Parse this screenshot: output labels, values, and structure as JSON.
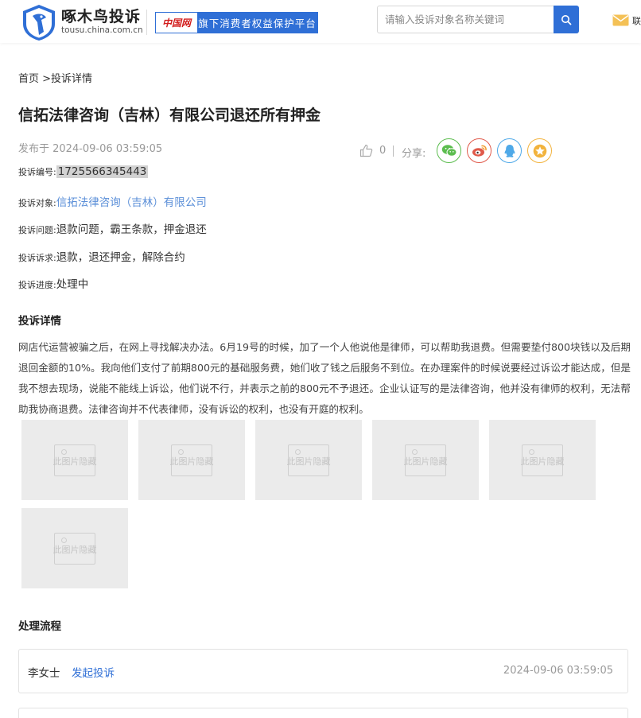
{
  "header": {
    "site_name": "啄木鸟投诉",
    "site_url": "tousu.china.com.cn",
    "partner_logo_text": "中国网",
    "partner_tagline": "旗下消费者权益保护平台",
    "search_placeholder": "请输入投诉对象名称关键词",
    "user_label": "联",
    "brand_color": "#2f6fd6"
  },
  "breadcrumb": {
    "home": "首页",
    "separator": " >",
    "current": "投诉详情"
  },
  "complaint": {
    "title": "信拓法律咨询（吉林）有限公司退还所有押金",
    "publish_time": "发布于 2024-09-06 03:59:05",
    "like_count": "0",
    "share_label": "分享:",
    "share_buttons": [
      "wechat-icon",
      "weibo-icon",
      "qq-icon",
      "qzone-icon"
    ],
    "fields": [
      {
        "label": "投诉编号:",
        "value": "1725566345443"
      },
      {
        "label": "投诉对象:",
        "value": "信拓法律咨询（吉林）有限公司"
      },
      {
        "label": "投诉问题:",
        "value": "退款问题，霸王条款，押金退还"
      },
      {
        "label": "投诉诉求:",
        "value": "退款，退还押金，解除合约"
      },
      {
        "label": "投诉进度:",
        "value": "处理中"
      }
    ]
  },
  "details": {
    "heading": "投诉详情",
    "text": "网店代运营被骗之后，在网上寻找解决办法。6月19号的时候，加了一个人他说他是律师，可以帮助我退费。但需要垫付800块钱以及后期退回金额的10%。我向他们支付了前期800元的基础服务费，她们收了钱之后服务不到位。在办理案件的时候说要经过诉讼才能达成，但是我不想去现场，说能不能线上诉讼，他们说不行，并表示之前的800元不予退还。企业认证写的是法律咨询，他并没有律师的权利，无法帮助我协商退费。法律咨询并不代表律师，没有诉讼的权利，也没有开庭的权利。",
    "image_placeholder_text": "此图片隐藏",
    "image_count": 6
  },
  "process": {
    "heading": "处理流程",
    "steps": [
      {
        "name": "李女士",
        "action": "发起投诉",
        "time": "2024-09-06 03:59:05"
      }
    ]
  }
}
